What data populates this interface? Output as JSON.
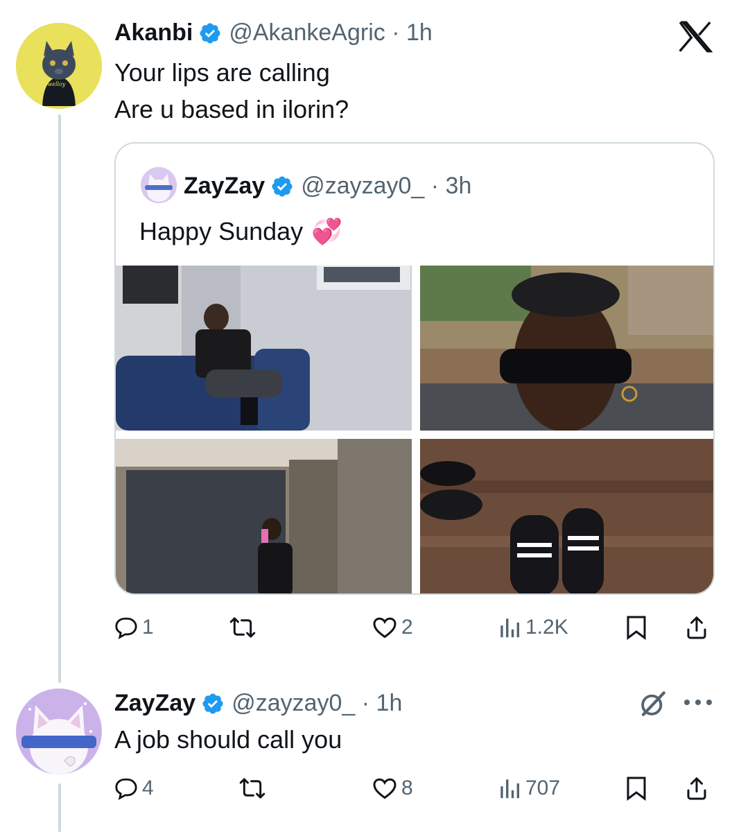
{
  "reply_tweet": {
    "display_name": "Akanbi",
    "handle_time": "@AkankeAgric · 1h",
    "lines": [
      "Your lips are calling",
      "Are u based in ilorin?"
    ],
    "avatar_text": "Dwelloy"
  },
  "quoted_tweet": {
    "display_name": "ZayZay",
    "handle_time": "@zayzay0_ · 3h",
    "text": "Happy Sunday",
    "emoji": "💞"
  },
  "reply_actions": {
    "replies": "1",
    "reposts": "",
    "likes": "2",
    "views": "1.2K"
  },
  "response_tweet": {
    "display_name": "ZayZay",
    "handle_time": "@zayzay0_ · 1h",
    "text": "A job should call you"
  },
  "response_actions": {
    "replies": "4",
    "reposts": "",
    "likes": "8",
    "views": "707"
  },
  "colors": {
    "verified_blue": "#1d9bf0",
    "secondary_text": "#536471",
    "icon_gray": "#536471"
  },
  "icons": [
    "x-logo-icon",
    "verified-icon",
    "reply-icon",
    "repost-icon",
    "like-icon",
    "views-icon",
    "bookmark-icon",
    "share-icon",
    "grok-icon",
    "more-icon"
  ]
}
